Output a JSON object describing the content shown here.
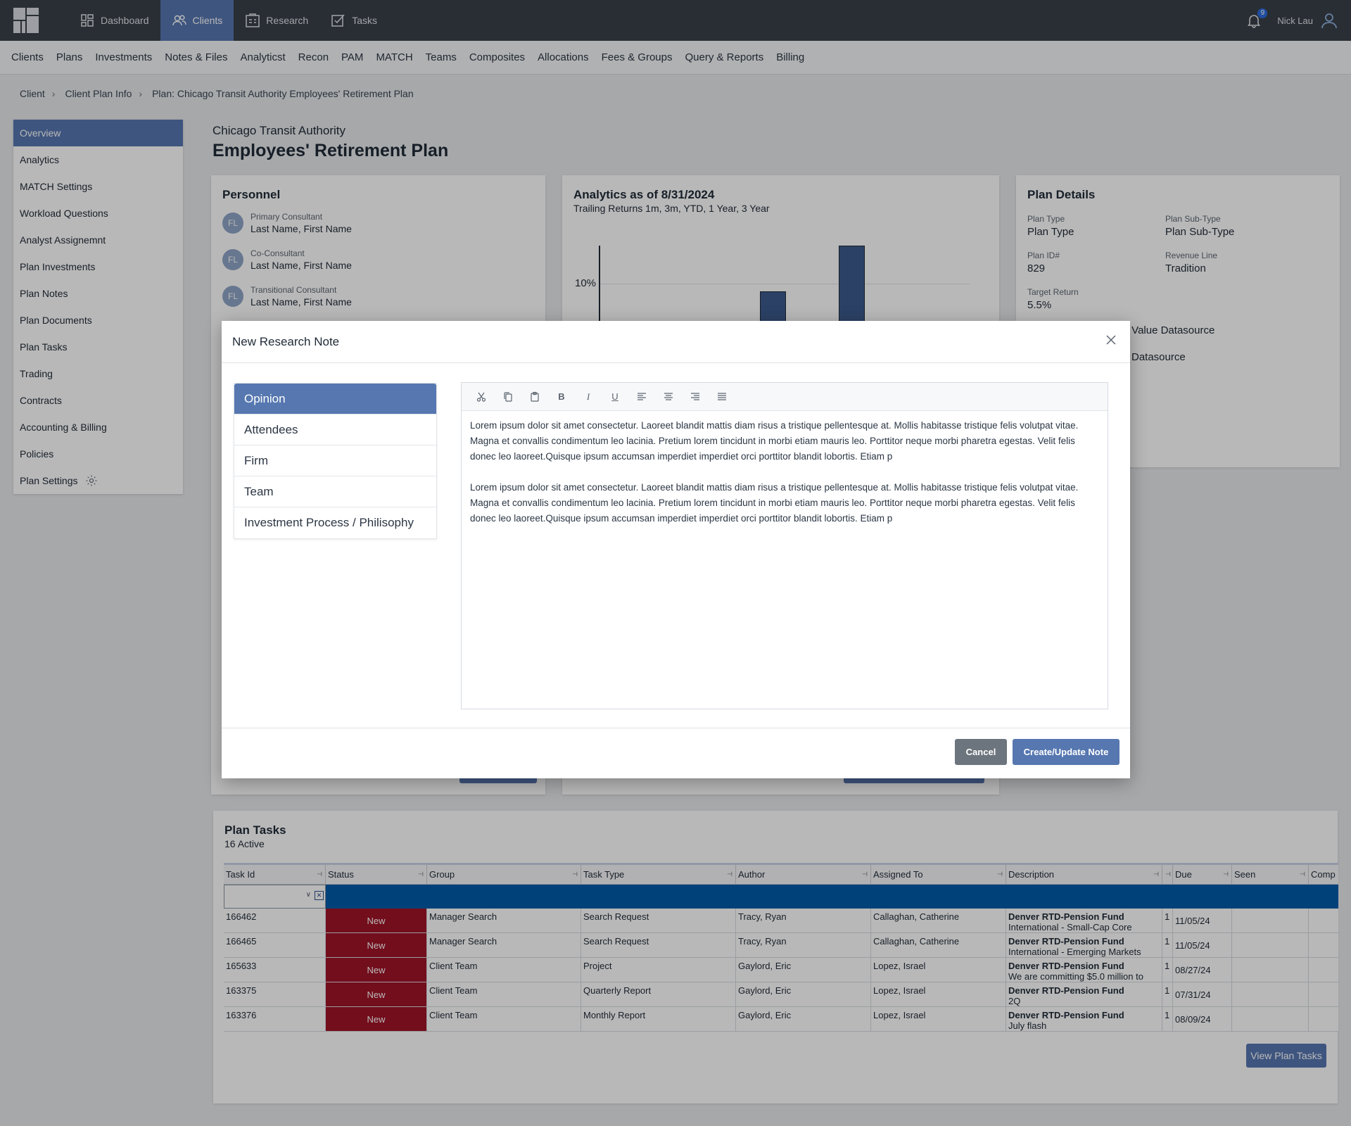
{
  "topnav": {
    "items": [
      {
        "label": "Dashboard",
        "icon": "dashboard-icon"
      },
      {
        "label": "Clients",
        "icon": "clients-icon"
      },
      {
        "label": "Research",
        "icon": "research-icon"
      },
      {
        "label": "Tasks",
        "icon": "tasks-icon"
      }
    ],
    "notifications_count": "9",
    "user_name": "Nick Lau"
  },
  "subnav": [
    "Clients",
    "Plans",
    "Investments",
    "Notes & Files",
    "Analyticst",
    "Recon",
    "PAM",
    "MATCH",
    "Teams",
    "Composites",
    "Allocations",
    "Fees & Groups",
    "Query & Reports",
    "Billing"
  ],
  "breadcrumb": [
    "Client",
    "Client Plan Info",
    "Plan: Chicago Transit Authority Employees' Retirement Plan"
  ],
  "sidebar": [
    "Overview",
    "Analytics",
    "MATCH Settings",
    "Workload Questions",
    "Analyst Assignemnt",
    "Plan Investments",
    "Plan Notes",
    "Plan Documents",
    "Plan Tasks",
    "Trading",
    "Contracts",
    "Accounting & Billing",
    "Policies",
    "Plan Settings"
  ],
  "header": {
    "client": "Chicago Transit Authority",
    "plan": "Employees' Retirement Plan"
  },
  "personnel": {
    "title": "Personnel",
    "people": [
      {
        "initials": "FL",
        "role": "Primary Consultant",
        "name": "Last Name, First Name"
      },
      {
        "initials": "FL",
        "role": "Co-Consultant",
        "name": "Last Name, First Name"
      },
      {
        "initials": "FL",
        "role": "Transitional Consultant",
        "name": "Last Name, First Name"
      }
    ]
  },
  "analytics": {
    "title": "Analytics as of 8/31/2024",
    "subtitle": "Trailing Returns 1m, 3m, YTD, 1 Year, 3 Year",
    "y_tick": "10%"
  },
  "plan_details": {
    "title": "Plan Details",
    "fields": [
      {
        "label": "Plan Type",
        "value": "Plan Type"
      },
      {
        "label": "Plan Sub-Type",
        "value": "Plan Sub-Type"
      },
      {
        "label": "Plan ID#",
        "value": "829"
      },
      {
        "label": "Revenue Line",
        "value": "Tradition"
      },
      {
        "label": "Target Return",
        "value": "5.5%"
      }
    ],
    "partial_1": "ket Value Datasource",
    "partial_2": "Datasource"
  },
  "modal": {
    "title": "New Research Note",
    "tabs": [
      "Opinion",
      "Attendees",
      "Firm",
      "Team",
      "Investment Process / Philisophy"
    ],
    "paragraphs": [
      "Lorem ipsum dolor sit amet consectetur. Laoreet blandit mattis diam risus a tristique pellentesque at. Mollis habitasse tristique felis volutpat vitae. Magna et convallis condimentum leo lacinia. Pretium lorem tincidunt in morbi etiam mauris leo. Porttitor neque morbi pharetra egestas. Velit felis donec leo laoreet.Quisque ipsum accumsan imperdiet imperdiet orci porttitor blandit lobortis. Etiam p",
      "Lorem ipsum dolor sit amet consectetur. Laoreet blandit mattis diam risus a tristique pellentesque at. Mollis habitasse tristique felis volutpat vitae. Magna et convallis condimentum leo lacinia. Pretium lorem tincidunt in morbi etiam mauris leo. Porttitor neque morbi pharetra egestas. Velit felis donec leo laoreet.Quisque ipsum accumsan imperdiet imperdiet orci porttitor blandit lobortis. Etiam p"
    ],
    "cancel_label": "Cancel",
    "submit_label": "Create/Update Note"
  },
  "plan_tasks": {
    "title": "Plan Tasks",
    "subtitle": "16 Active",
    "columns": [
      "Task Id",
      "Status",
      "Group",
      "Task Type",
      "Author",
      "Assigned To",
      "Description",
      "",
      "Due",
      "Seen",
      "Comp"
    ],
    "rows": [
      {
        "id": "166462",
        "status": "New",
        "group": "Manager Search",
        "type": "Search Request",
        "author": "Tracy, Ryan",
        "assigned": "Callaghan, Catherine",
        "desc_title": "Denver RTD-Pension Fund",
        "desc_sub": "International - Small-Cap Core",
        "count": "1",
        "due": "11/05/24"
      },
      {
        "id": "166465",
        "status": "New",
        "group": "Manager Search",
        "type": "Search Request",
        "author": "Tracy, Ryan",
        "assigned": "Callaghan, Catherine",
        "desc_title": "Denver RTD-Pension Fund",
        "desc_sub": "International - Emerging Markets",
        "count": "1",
        "due": "11/05/24"
      },
      {
        "id": "165633",
        "status": "New",
        "group": "Client Team",
        "type": "Project",
        "author": "Gaylord, Eric",
        "assigned": "Lopez, Israel",
        "desc_title": "Denver RTD-Pension Fund",
        "desc_sub": "We are committing $5.0 million to",
        "count": "1",
        "due": "08/27/24"
      },
      {
        "id": "163375",
        "status": "New",
        "group": "Client Team",
        "type": "Quarterly Report",
        "author": "Gaylord, Eric",
        "assigned": "Lopez, Israel",
        "desc_title": "Denver RTD-Pension Fund",
        "desc_sub": "2Q",
        "count": "1",
        "due": "07/31/24"
      },
      {
        "id": "163376",
        "status": "New",
        "group": "Client Team",
        "type": "Monthly Report",
        "author": "Gaylord, Eric",
        "assigned": "Lopez, Israel",
        "desc_title": "Denver RTD-Pension Fund",
        "desc_sub": "July flash",
        "count": "1",
        "due": "08/09/24"
      }
    ],
    "view_button": "View Plan Tasks"
  },
  "colors": {
    "accent": "#5677b0",
    "topbar": "#3a4049",
    "status_new": "#a01428",
    "filter_row": "#005aa9"
  }
}
